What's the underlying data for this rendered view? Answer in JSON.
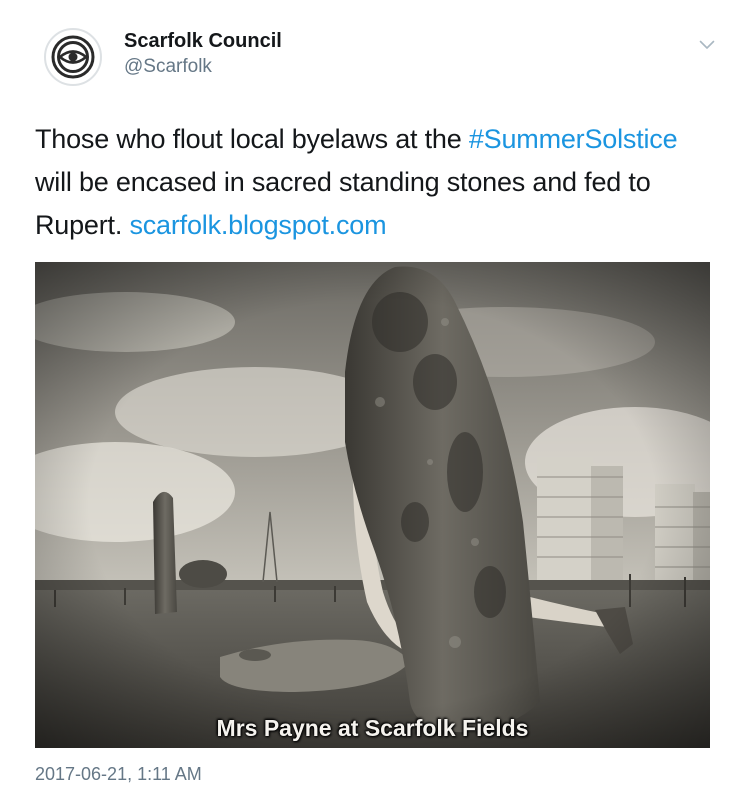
{
  "author": {
    "name": "Scarfolk Council",
    "handle": "@Scarfolk",
    "avatar_icon": "concentric-eye-icon"
  },
  "menu": {
    "icon": "chevron-down-icon"
  },
  "tweet": {
    "text_part1": "Those who flout local byelaws at the ",
    "hashtag": "#SummerSolstice",
    "text_part2": " will be encased in sacred standing stones and fed to Rupert. ",
    "url": "scarfolk.blogspot.com"
  },
  "media": {
    "caption": "Mrs Payne at Scarfolk Fields"
  },
  "meta": {
    "timestamp": "2017-06-21, 1:11 AM"
  },
  "colors": {
    "link": "#1b95e0",
    "secondary_text": "#657786",
    "primary_text": "#14171a"
  }
}
